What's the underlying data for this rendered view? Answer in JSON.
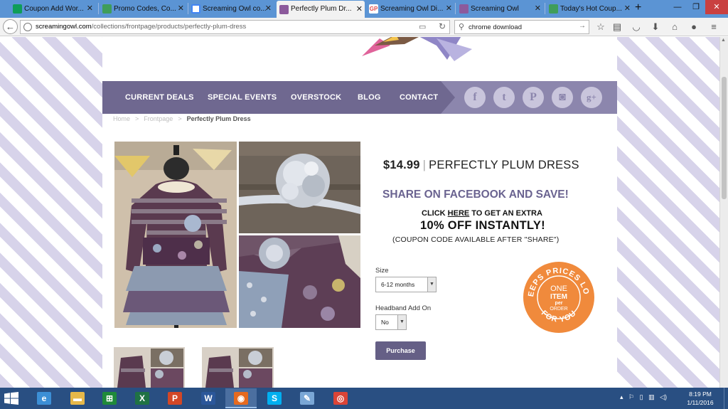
{
  "browser": {
    "tabs": [
      {
        "title": "Coupon Add Wor...",
        "icon_color": "#0f9d58",
        "active": false
      },
      {
        "title": "Promo Codes, Co...",
        "icon_color": "#3f9d5a",
        "active": false
      },
      {
        "title": "Screaming Owl co...",
        "icon_color": "#4285f4",
        "active": false
      },
      {
        "title": "Perfectly Plum Dr...",
        "icon_color": "#8c5a9c",
        "active": true
      },
      {
        "title": "Screaming Owl Di...",
        "icon_color": "#e04b4b",
        "active": false
      },
      {
        "title": "Screaming Owl",
        "icon_color": "#8c5a9c",
        "active": false
      },
      {
        "title": "Today's Hot Coup...",
        "icon_color": "#3f9d5a",
        "active": false
      }
    ],
    "url_host": "screamingowl.com",
    "url_path": "/collections/frontpage/products/perfectly-plum-dress",
    "search_value": "chrome download"
  },
  "site": {
    "nav": [
      "CURRENT DEALS",
      "SPECIAL EVENTS",
      "OVERSTOCK",
      "BLOG",
      "CONTACT"
    ],
    "social": [
      {
        "name": "facebook-icon",
        "glyph": "f"
      },
      {
        "name": "twitter-icon",
        "glyph": "t"
      },
      {
        "name": "pinterest-icon",
        "glyph": "P"
      },
      {
        "name": "instagram-icon",
        "glyph": "◙"
      },
      {
        "name": "google-plus-icon",
        "glyph": "g+"
      }
    ],
    "brand_color": "#6f6890",
    "accent_color": "#f08a3c"
  },
  "breadcrumb": {
    "home": "Home",
    "sep": ">",
    "section": "Frontpage",
    "current": "Perfectly Plum Dress"
  },
  "product": {
    "price": "$14.99",
    "name": "PERFECTLY PLUM DRESS",
    "share_headline": "SHARE ON FACEBOOK AND SAVE!",
    "click_prefix": "CLICK ",
    "click_link": "HERE",
    "click_suffix": " TO GET AN EXTRA",
    "discount": "10% OFF INSTANTLY!",
    "coupon_note": "(COUPON CODE AVAILABLE AFTER \"SHARE\")",
    "size_label": "Size",
    "size_value": "6-12 months",
    "headband_label": "Headband Add On",
    "headband_value": "No",
    "purchase_label": "Purchase"
  },
  "badge": {
    "arc_top": "KEEPS PRICES LOW",
    "arc_bottom": "FOR YOU",
    "line1": "ONE",
    "line2": "ITEM",
    "line3": "per",
    "line4": "ORDER"
  },
  "taskbar": {
    "apps": [
      {
        "name": "internet-explorer-app",
        "glyph": "e",
        "color": "#3c8fd6"
      },
      {
        "name": "file-explorer-app",
        "glyph": "▬",
        "color": "#e6b84a"
      },
      {
        "name": "store-app",
        "glyph": "⊞",
        "color": "#1f8a3a"
      },
      {
        "name": "excel-app",
        "glyph": "X",
        "color": "#1f7244"
      },
      {
        "name": "powerpoint-app",
        "glyph": "P",
        "color": "#d24726"
      },
      {
        "name": "word-app",
        "glyph": "W",
        "color": "#2b579a"
      },
      {
        "name": "firefox-app",
        "glyph": "◉",
        "color": "#e66a1f"
      },
      {
        "name": "skype-app",
        "glyph": "S",
        "color": "#00aff0"
      },
      {
        "name": "paint-app",
        "glyph": "✎",
        "color": "#7aa7d6"
      },
      {
        "name": "chrome-app",
        "glyph": "◎",
        "color": "#db4437"
      }
    ],
    "time": "8:19 PM",
    "date": "1/11/2016"
  }
}
